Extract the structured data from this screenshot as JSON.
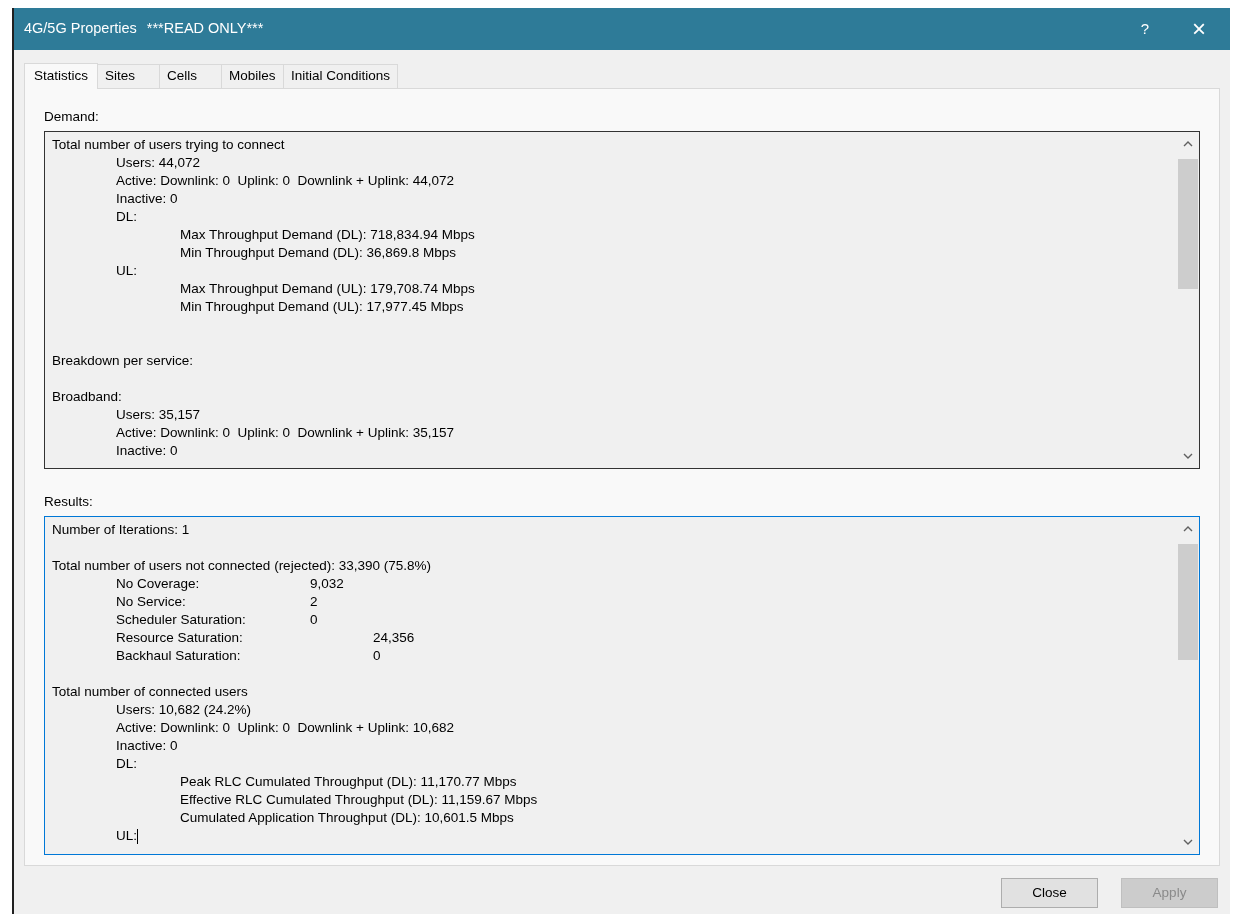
{
  "window": {
    "title": "4G/5G Properties",
    "subtitle": "***READ ONLY***",
    "help": "?",
    "close": "×"
  },
  "tabs": [
    {
      "label": "Statistics",
      "selected": true
    },
    {
      "label": "Sites",
      "selected": false
    },
    {
      "label": "Cells",
      "selected": false
    },
    {
      "label": "Mobiles",
      "selected": false
    },
    {
      "label": "Initial Conditions",
      "selected": false
    }
  ],
  "demand": {
    "label": "Demand:",
    "focused": false,
    "sections": [
      {
        "lines": [
          {
            "text": "Total number of users trying to connect",
            "children": [
              {
                "text": "Users: 44,072"
              },
              {
                "text": "Active: Downlink: 0  Uplink: 0  Downlink + Uplink: 44,072"
              },
              {
                "text": "Inactive: 0"
              },
              {
                "text": "DL:",
                "children": [
                  {
                    "text": "Max Throughput Demand (DL): 718,834.94 Mbps"
                  },
                  {
                    "text": "Min Throughput Demand (DL): 36,869.8 Mbps"
                  }
                ]
              },
              {
                "text": "UL:",
                "children": [
                  {
                    "text": "Max Throughput Demand (UL): 179,708.74 Mbps"
                  },
                  {
                    "text": "Min Throughput Demand (UL): 17,977.45 Mbps"
                  }
                ]
              }
            ]
          }
        ]
      },
      {
        "wide_gap": true,
        "lines": [
          {
            "text": "Breakdown per service:"
          }
        ]
      },
      {
        "lines": [
          {
            "text": "Broadband:",
            "children": [
              {
                "text": "Users: 35,157"
              },
              {
                "text": "Active: Downlink: 0  Uplink: 0  Downlink + Uplink: 35,157"
              },
              {
                "text": "Inactive: 0"
              }
            ]
          }
        ]
      }
    ]
  },
  "results": {
    "label": "Results:",
    "focused": true,
    "sections": [
      {
        "lines": [
          {
            "text": "Number of Iterations: 1"
          }
        ]
      },
      {
        "lines": [
          {
            "text": "Total number of users not connected (rejected): 33,390 (75.8%)",
            "children": [
              {
                "text": "No Coverage:",
                "value": "9,032",
                "kind": "near"
              },
              {
                "text": "No Service:",
                "value": "2",
                "kind": "near"
              },
              {
                "text": "Scheduler Saturation:",
                "value": "0",
                "kind": "near"
              },
              {
                "text": "Resource Saturation:",
                "value": "24,356",
                "kind": "far"
              },
              {
                "text": "Backhaul Saturation:",
                "value": "0",
                "kind": "far"
              }
            ]
          }
        ]
      },
      {
        "lines": [
          {
            "text": "Total number of connected users",
            "children": [
              {
                "text": "Users: 10,682 (24.2%)"
              },
              {
                "text": "Active: Downlink: 0  Uplink: 0  Downlink + Uplink: 10,682"
              },
              {
                "text": "Inactive: 0"
              },
              {
                "text": "DL:",
                "children": [
                  {
                    "text": "Peak RLC Cumulated Throughput (DL): 11,170.77 Mbps"
                  },
                  {
                    "text": "Effective RLC Cumulated Throughput (DL): 11,159.67 Mbps"
                  },
                  {
                    "text": "Cumulated Application Throughput (DL): 10,601.5 Mbps"
                  }
                ]
              },
              {
                "text": "UL:",
                "caret": true
              }
            ]
          }
        ]
      }
    ]
  },
  "buttons": [
    {
      "label": "Close",
      "disabled": false
    },
    {
      "label": "Apply",
      "disabled": true
    }
  ]
}
